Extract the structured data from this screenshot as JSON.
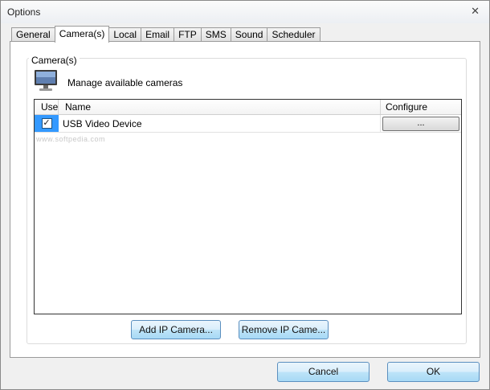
{
  "window": {
    "title": "Options"
  },
  "tabs": [
    {
      "label": "General",
      "active": false
    },
    {
      "label": "Camera(s)",
      "active": true
    },
    {
      "label": "Local",
      "active": false
    },
    {
      "label": "Email",
      "active": false
    },
    {
      "label": "FTP",
      "active": false
    },
    {
      "label": "SMS",
      "active": false
    },
    {
      "label": "Sound",
      "active": false
    },
    {
      "label": "Scheduler",
      "active": false
    }
  ],
  "group": {
    "legend": "Camera(s)",
    "description": "Manage available cameras"
  },
  "table": {
    "headers": {
      "use": "Use",
      "name": "Name",
      "configure": "Configure"
    },
    "rows": [
      {
        "checked": "✓",
        "name": "USB Video Device",
        "configure_label": "..."
      }
    ]
  },
  "watermark": "www.softpedia.com",
  "buttons": {
    "add_ip": "Add IP Camera...",
    "remove_ip": "Remove  IP Came...",
    "cancel": "Cancel",
    "ok": "OK"
  },
  "icons": {
    "close": "close-icon",
    "monitor": "monitor-icon"
  },
  "colors": {
    "selection": "#3399ff",
    "accent_button": "#bee4f8"
  }
}
